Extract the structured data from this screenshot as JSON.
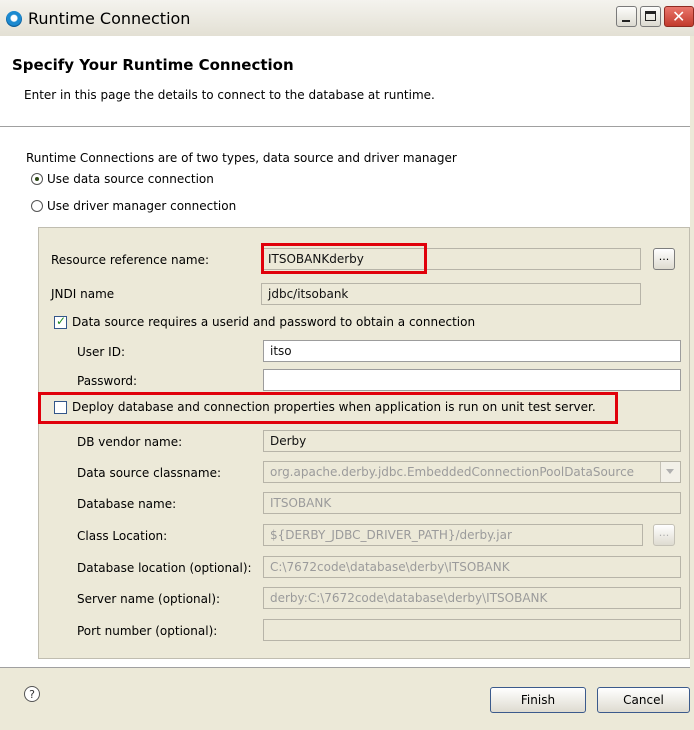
{
  "window": {
    "title": "Runtime Connection"
  },
  "banner": {
    "title": "Specify Your Runtime Connection",
    "description": "Enter in this page the details to connect to the database at runtime."
  },
  "connection_types": {
    "intro": "Runtime Connections are of two types, data source and driver manager",
    "data_source_label": "Use data source connection",
    "data_source_selected": true,
    "driver_manager_label": "Use driver manager connection",
    "driver_manager_selected": false
  },
  "fields": {
    "resource_ref_label": "Resource reference name:",
    "resource_ref_value": "ITSOBANKderby",
    "browse_label": "...",
    "jndi_label": "JNDI name",
    "jndi_value": "jdbc/itsobank",
    "requires_auth_label": "Data source requires a userid and password to obtain a connection",
    "requires_auth_checked": true,
    "userid_label": "User ID:",
    "userid_value": "itso",
    "password_label": "Password:",
    "password_value": "",
    "deploy_label": "Deploy database and connection properties when application is run on unit test server.",
    "deploy_checked": false,
    "vendor_label": "DB vendor name:",
    "vendor_value": "Derby",
    "classname_label": "Data source classname:",
    "classname_value": "org.apache.derby.jdbc.EmbeddedConnectionPoolDataSource",
    "dbname_label": "Database name:",
    "dbname_value": "ITSOBANK",
    "classloc_label": "Class Location:",
    "classloc_value": "${DERBY_JDBC_DRIVER_PATH}/derby.jar",
    "classloc_browse_label": "...",
    "dbloc_label": "Database location (optional):",
    "dbloc_value": "C:\\7672code\\database\\derby\\ITSOBANK",
    "server_label": "Server name (optional):",
    "server_value": "derby:C:\\7672code\\database\\derby\\ITSOBANK",
    "port_label": "Port number (optional):",
    "port_value": ""
  },
  "footer": {
    "help_icon": "?",
    "finish_label": "Finish",
    "cancel_label": "Cancel"
  },
  "colors": {
    "highlight_red": "#e0000b",
    "dialog_bg": "#ece9d8"
  },
  "icons": [
    "app-icon",
    "minimize-icon",
    "maximize-icon",
    "close-icon",
    "help-icon",
    "chevron-down-icon"
  ]
}
